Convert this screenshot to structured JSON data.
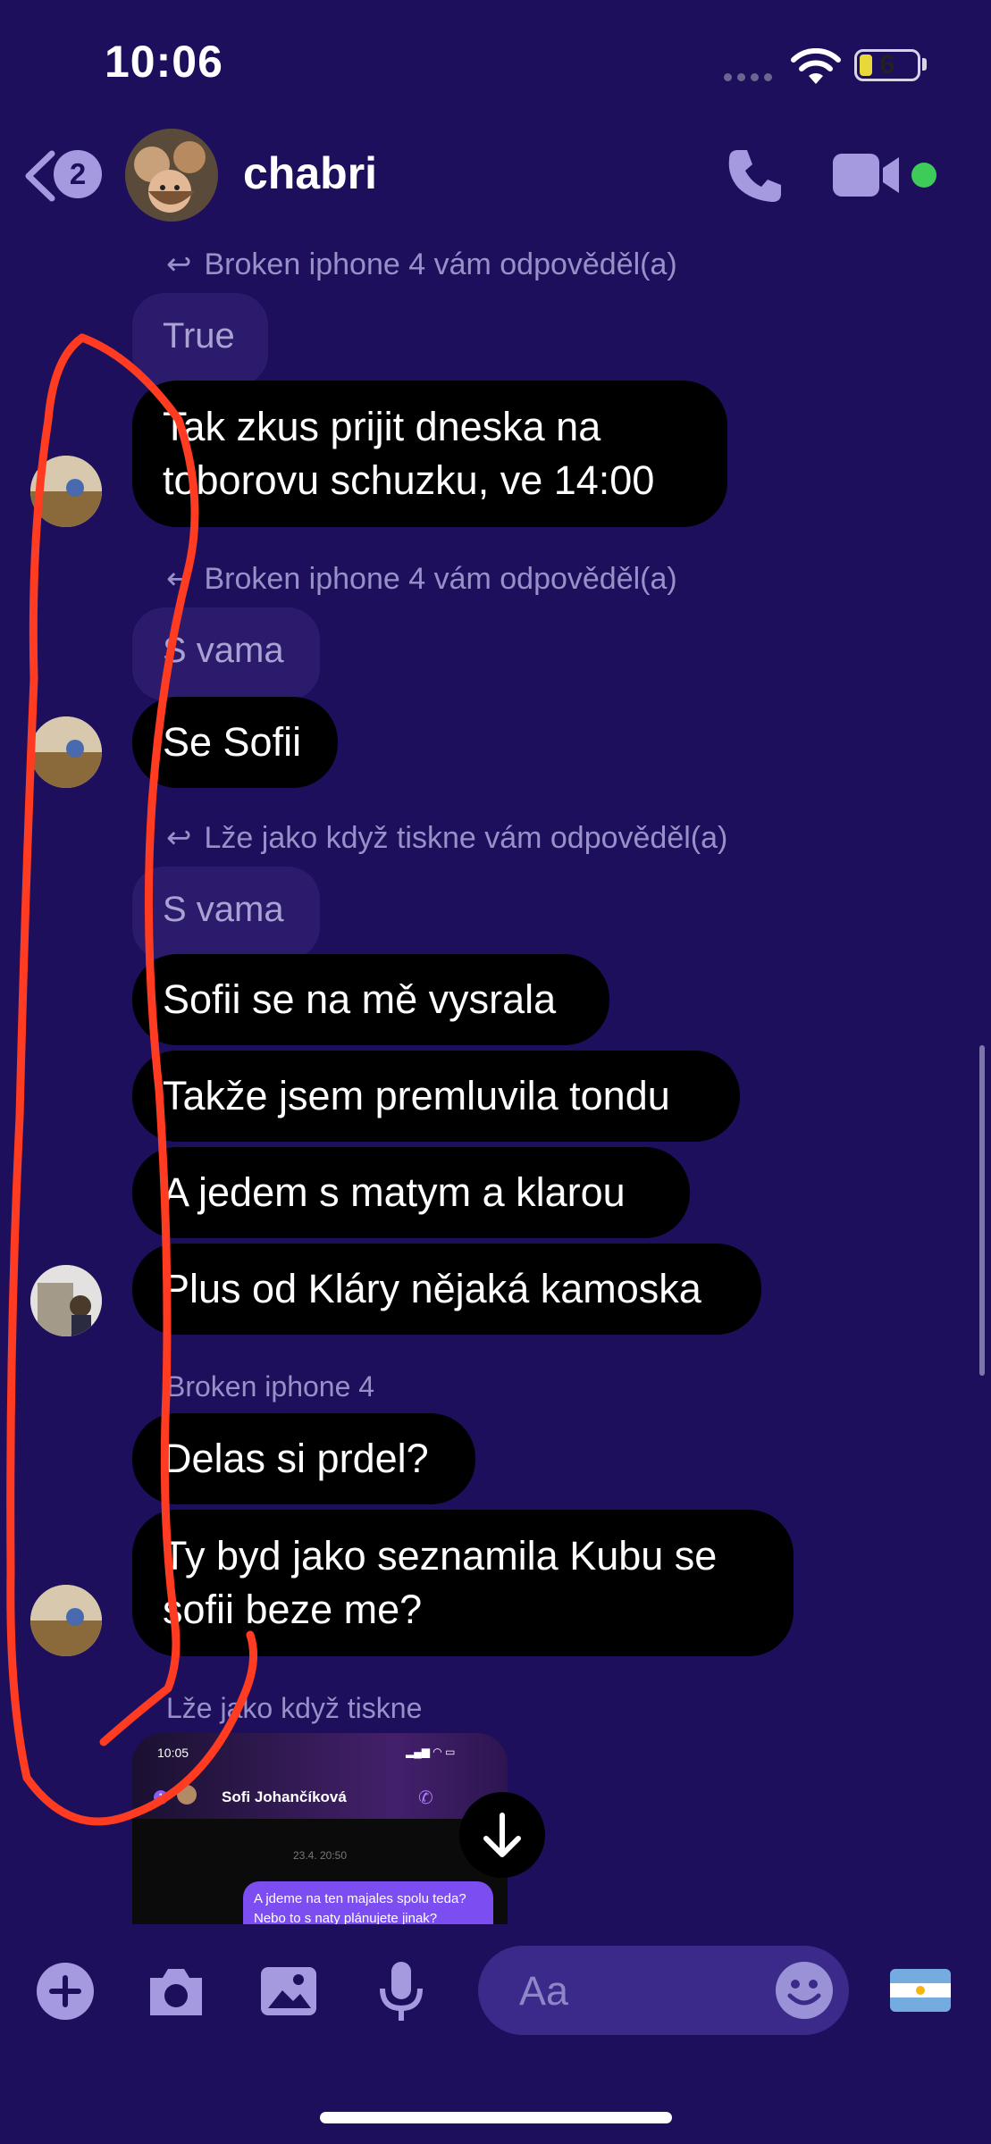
{
  "status_bar": {
    "time": "10:06",
    "battery": "6"
  },
  "header": {
    "back_badge": "2",
    "title": "chabri"
  },
  "messages": [
    {
      "reply_note": "Broken iphone 4 vám odpověděl(a)",
      "quote": "True",
      "bubbles": [
        "Tak zkus prijit dneska na toborovu schuzku, ve 14:00"
      ]
    },
    {
      "reply_note": "Broken iphone 4 vám odpověděl(a)",
      "quote": "S vama",
      "bubbles": [
        "Se Sofii"
      ]
    },
    {
      "reply_note": "Lže jako když tiskne vám odpověděl(a)",
      "quote": "S vama",
      "bubbles": [
        "Sofii se na mě vysrala",
        "Takže jsem premluvila tondu",
        "A jedem s matym a klarou",
        "Plus od Kláry nějaká kamoska"
      ]
    },
    {
      "sender": "Broken iphone 4",
      "bubbles": [
        "Delas si prdel?",
        "Ty byd jako seznamila Kubu se sofii beze me?"
      ]
    },
    {
      "sender": "Lže jako když tiskne"
    }
  ],
  "shared_screenshot": {
    "time": "10:05",
    "badge": "1",
    "contact_name": "Sofi Johančíková",
    "date": "23.4. 20:50",
    "message": "A jdeme na ten majales spolu teda? Nebo to s naty plánujete jinak?"
  },
  "composer": {
    "placeholder": "Aa"
  },
  "colors": {
    "background": "#1d0f5c",
    "bubble": "#000000",
    "quote": "#2c1b6c",
    "accent": "#a59ae0",
    "online": "#3dcc5a",
    "annotation": "#ff3b22"
  },
  "icons": [
    "chevron-left-icon",
    "phone-icon",
    "video-camera-icon",
    "reply-arrow-icon",
    "arrow-down-icon",
    "plus-icon",
    "camera-icon",
    "image-icon",
    "microphone-icon",
    "emoji-icon",
    "argentina-flag-icon"
  ]
}
